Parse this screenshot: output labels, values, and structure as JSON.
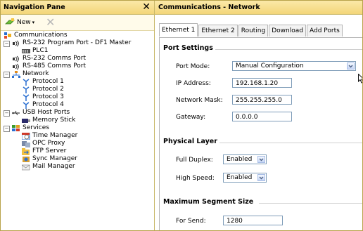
{
  "nav": {
    "title": "Navigation Pane",
    "new_label": "New",
    "tree": [
      {
        "label": "Communications",
        "icon": "communications-icon"
      },
      {
        "label": "RS-232 Program Port - DF1 Master",
        "icon": "serial-port-icon"
      },
      {
        "label": "PLC1",
        "icon": "plc-icon"
      },
      {
        "label": "RS-232 Comms Port",
        "icon": "serial-port-icon"
      },
      {
        "label": "RS-485 Comms Port",
        "icon": "serial-port-icon"
      },
      {
        "label": "Network",
        "icon": "network-icon"
      },
      {
        "label": "Protocol 1",
        "icon": "protocol-icon"
      },
      {
        "label": "Protocol 2",
        "icon": "protocol-icon"
      },
      {
        "label": "Protocol 3",
        "icon": "protocol-icon"
      },
      {
        "label": "Protocol 4",
        "icon": "protocol-icon"
      },
      {
        "label": "USB Host Ports",
        "icon": "usb-icon"
      },
      {
        "label": "Memory Stick",
        "icon": "memory-stick-icon"
      },
      {
        "label": "Services",
        "icon": "services-icon"
      },
      {
        "label": "Time Manager",
        "icon": "time-manager-icon"
      },
      {
        "label": "OPC Proxy",
        "icon": "opc-proxy-icon"
      },
      {
        "label": "FTP Server",
        "icon": "ftp-server-icon"
      },
      {
        "label": "Sync Manager",
        "icon": "sync-manager-icon"
      },
      {
        "label": "Mail Manager",
        "icon": "mail-manager-icon"
      }
    ]
  },
  "comm": {
    "title": "Communications - Network",
    "tabs": [
      "Ethernet 1",
      "Ethernet 2",
      "Routing",
      "Download",
      "Add Ports"
    ],
    "port_settings": {
      "title": "Port Settings",
      "port_mode_label": "Port Mode:",
      "port_mode_value": "Manual Configuration",
      "ip_label": "IP Address:",
      "ip_value": "192.168.1.20",
      "mask_label": "Network Mask:",
      "mask_value": "255.255.255.0",
      "gateway_label": "Gateway:",
      "gateway_value": "0.0.0.0"
    },
    "physical_layer": {
      "title": "Physical Layer",
      "duplex_label": "Full Duplex:",
      "duplex_value": "Enabled",
      "speed_label": "High Speed:",
      "speed_value": "Enabled"
    },
    "segment": {
      "title": "Maximum Segment Size",
      "send_label": "For Send:",
      "send_value": "1280"
    }
  },
  "colors": {
    "header_gradient_top": "#fbe9a8",
    "header_gradient_bottom": "#f3d679",
    "border": "#c9b86a"
  }
}
